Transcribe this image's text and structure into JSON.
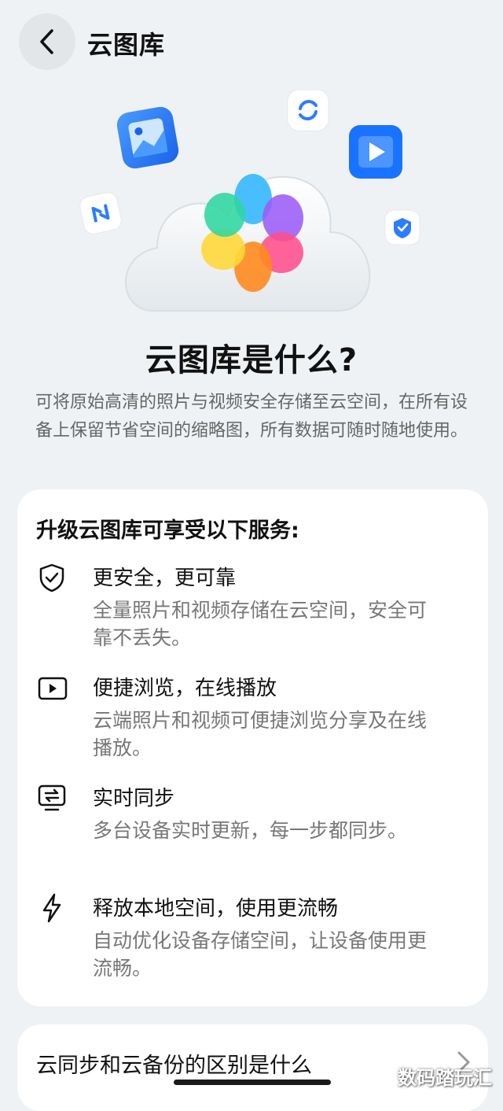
{
  "header": {
    "title": "云图库"
  },
  "hero": {
    "heading": "云图库是什么?",
    "description": "可将原始高清的照片与视频安全存储至云空间，在所有设备上保留节省空间的缩略图，所有数据可随时随地使用。"
  },
  "services": {
    "title": "升级云图库可享受以下服务:",
    "features": [
      {
        "icon": "shield-icon",
        "title": "更安全，更可靠",
        "description": "全量照片和视频存储在云空间，安全可靠不丢失。"
      },
      {
        "icon": "play-icon",
        "title": "便捷浏览，在线播放",
        "description": "云端照片和视频可便捷浏览分享及在线播放。"
      },
      {
        "icon": "sync-icon",
        "title": "实时同步",
        "description": "多台设备实时更新，每一步都同步。"
      },
      {
        "icon": "lightning-icon",
        "title": "释放本地空间，使用更流畅",
        "description": "自动优化设备存储空间，让设备使用更流畅。"
      }
    ]
  },
  "faq": {
    "label": "云同步和云备份的区别是什么"
  },
  "watermark": "数码踏玩汇"
}
